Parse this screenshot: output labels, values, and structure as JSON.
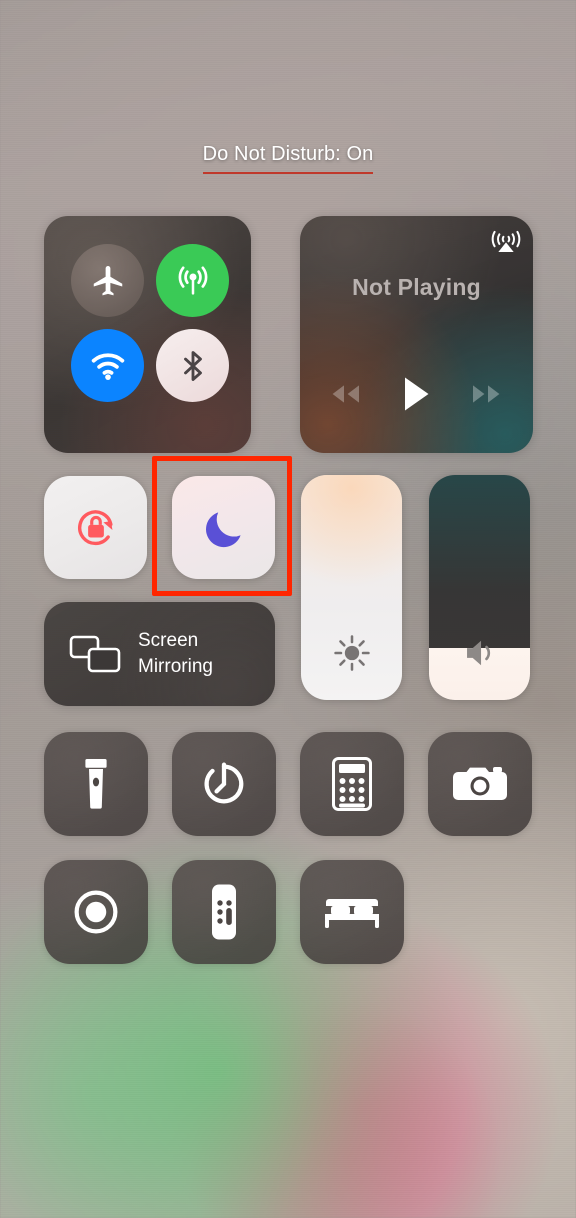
{
  "status": {
    "dnd_banner": "Do Not Disturb: On",
    "banner_underline_color": "#c0392b"
  },
  "connectivity": {
    "buttons": [
      {
        "name": "airplane-mode",
        "label": "Airplane Mode",
        "state": "off",
        "color": "#8d7d76"
      },
      {
        "name": "cellular-data",
        "label": "Cellular Data",
        "state": "on",
        "color": "#3ACA56"
      },
      {
        "name": "wifi",
        "label": "Wi-Fi",
        "state": "on",
        "color": "#0B84FF"
      },
      {
        "name": "bluetooth",
        "label": "Bluetooth",
        "state": "off",
        "color": "#f2e6e6"
      }
    ]
  },
  "media": {
    "title": "Not Playing",
    "airplay_label": "AirPlay",
    "controls": [
      {
        "name": "rewind",
        "label": "Rewind"
      },
      {
        "name": "play",
        "label": "Play"
      },
      {
        "name": "fast-forward",
        "label": "Fast Forward"
      }
    ]
  },
  "toggles": {
    "rotation_lock": {
      "label": "Rotation Lock",
      "state": "on",
      "icon_color": "#FF5A5F"
    },
    "do_not_disturb": {
      "label": "Do Not Disturb",
      "state": "on",
      "icon_color": "#5A50D6",
      "highlighted": true
    }
  },
  "highlight": {
    "color": "#ff2600"
  },
  "screen_mirroring": {
    "label": "Screen\nMirroring"
  },
  "sliders": {
    "brightness": {
      "label": "Brightness",
      "value": 100
    },
    "volume": {
      "label": "Volume",
      "value": 23
    }
  },
  "shortcuts": {
    "row1": [
      {
        "name": "flashlight",
        "label": "Flashlight"
      },
      {
        "name": "timer",
        "label": "Timer"
      },
      {
        "name": "calculator",
        "label": "Calculator"
      },
      {
        "name": "camera",
        "label": "Camera"
      }
    ],
    "row2": [
      {
        "name": "screen-recording",
        "label": "Screen Recording"
      },
      {
        "name": "apple-tv-remote",
        "label": "Apple TV Remote"
      },
      {
        "name": "sleep",
        "label": "Sleep"
      }
    ]
  }
}
